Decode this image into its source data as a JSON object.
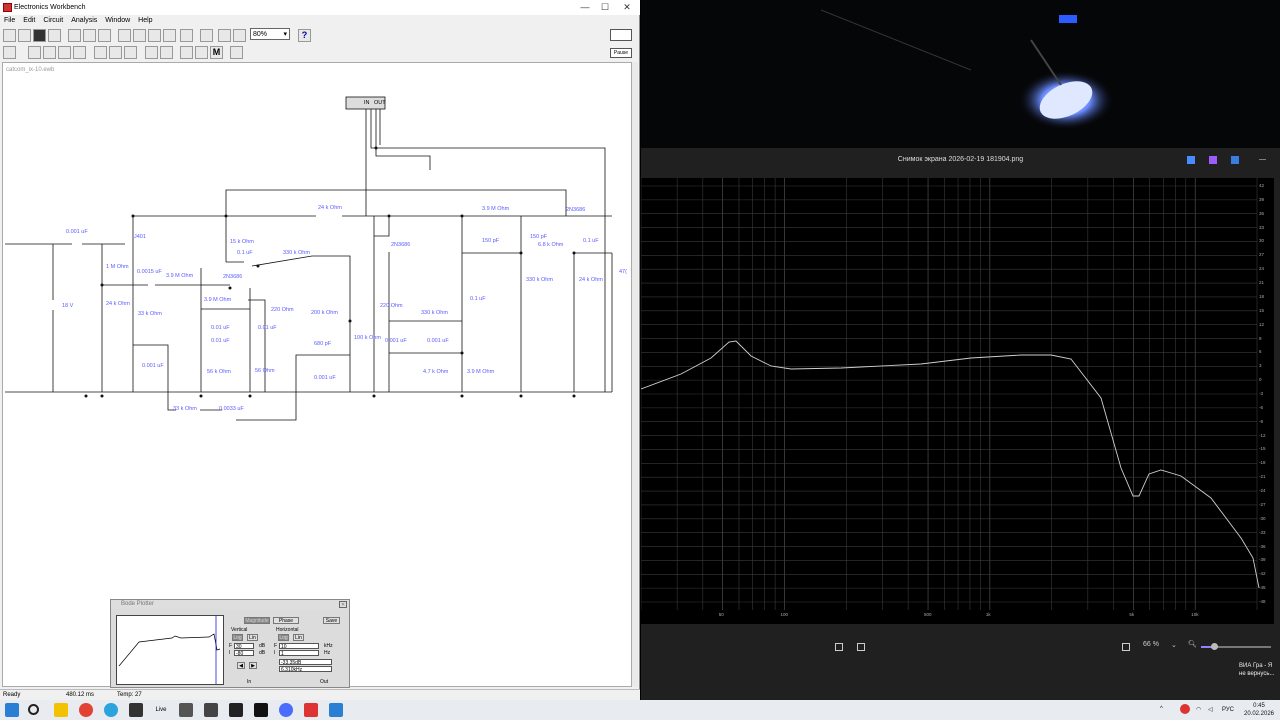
{
  "ewb": {
    "title": "Electronics Workbench",
    "menu": [
      "File",
      "Edit",
      "Circuit",
      "Analysis",
      "Window",
      "Help"
    ],
    "zoom": "80%",
    "pause_label": "Pause",
    "file_name": "catcom_ix-10.ewb",
    "status": {
      "left": "Ready",
      "time": "480.12 ms",
      "temp": "Temp:  27"
    },
    "labels": {
      "c1": "0.001 uF",
      "j": "J401",
      "r1": "1 M Ohm",
      "c2": "0.0015 uF",
      "r2": "3.9 M Ohm",
      "r3": "24 k Ohm",
      "bat": "18 V",
      "r4": "33 k Ohm",
      "c3": "0.001 uF",
      "r5": "15 k Ohm",
      "c4": "0.1 uF",
      "q1": "2N3686",
      "r6": "3.9 M Ohm",
      "c5": "0.01 uF",
      "c6": "0.01 uF",
      "c7": "0.01 uF",
      "r7": "56 k Ohm",
      "r8": "56 Ohm",
      "r9": "220  Ohm",
      "r10": "24 k Ohm",
      "r11": "330 k Ohm",
      "q2": "2N3686",
      "r12": "200 k Ohm",
      "c8": "680 pF",
      "r13": "100 k Ohm",
      "c9": "0.001 uF",
      "r14": "220  Ohm",
      "r15": "330 k Ohm",
      "c10": "0.001 uF",
      "c11": "0.001 uF",
      "r16": "4.7 k Ohm",
      "r17": "3.9 M Ohm",
      "c12": "0.1 uF",
      "r18": "3.9 M Ohm",
      "c13": "150 pF",
      "c14": "150 pF",
      "r19": "6.8 k Ohm",
      "q3": "2N3686",
      "c15": "0.1 uF",
      "r20": "330 k Ohm",
      "r21": "24 k Ohm",
      "r22": "47(",
      "r23": "33 k Ohm",
      "c16": "0.0033 uF",
      "bode_in": "IN",
      "bode_out": "OUT"
    }
  },
  "bode": {
    "title": "Bode Plotter",
    "magnitude": "Magnitude",
    "phase": "Phase",
    "save": "Save",
    "vertical": "Vertical",
    "horizontal": "Horizontal",
    "log": "Log",
    "lin": "Lin",
    "v_f_label": "F",
    "v_f_val": "30",
    "v_f_unit": "dB",
    "v_i_label": "I",
    "v_i_val": "-80",
    "v_i_unit": "dB",
    "h_f_label": "F",
    "h_f_val": "10",
    "h_f_unit": "kHz",
    "h_i_label": "I",
    "h_i_val": "1",
    "h_i_unit": "Hz",
    "readout_db": "-33.35dB",
    "readout_f": "6.310kHz",
    "in": "In",
    "out": "Out"
  },
  "viewer": {
    "title": "Снимок экрана 2026-02-19 181904.png",
    "zoom": "66 %",
    "x_ticks": [
      "50",
      "100",
      "500",
      "1k",
      "5k",
      "10k"
    ],
    "y_ticks": [
      "42",
      "39",
      "36",
      "33",
      "30",
      "27",
      "24",
      "21",
      "18",
      "15",
      "12",
      "9",
      "6",
      "3",
      "0",
      "-3",
      "-6",
      "-9",
      "-12",
      "-15",
      "-18",
      "-21",
      "-24",
      "-27",
      "-30",
      "-33",
      "-36",
      "-39",
      "-42",
      "-45",
      "-48"
    ]
  },
  "taskbar": {
    "media_line1": "ВИА Гра - Я",
    "media_line2": "не вернусь...",
    "lang": "РУС",
    "time": "0:45",
    "date": "20.02.2026"
  }
}
